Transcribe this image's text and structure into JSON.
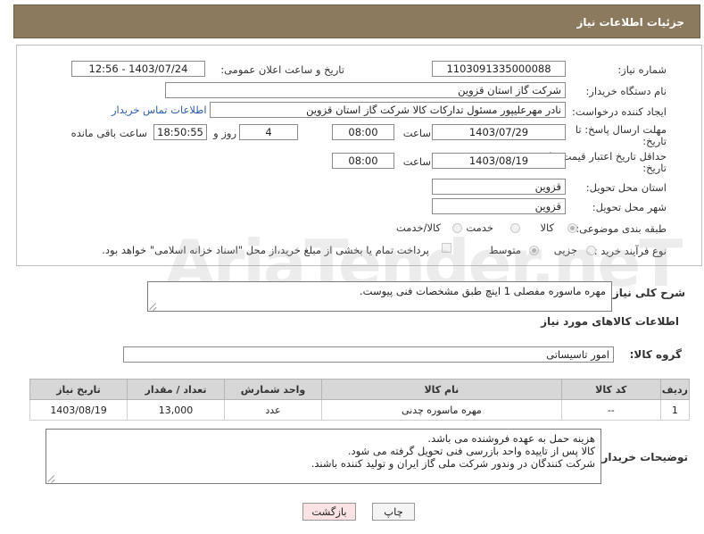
{
  "header": {
    "title": "جزئیات اطلاعات نیاز"
  },
  "form": {
    "need_number": {
      "label": "شماره نیاز:",
      "value": "1103091335000088"
    },
    "announce_datetime": {
      "label": "تاریخ و ساعت اعلان عمومی:",
      "value": "1403/07/24 - 12:56"
    },
    "buyer_org": {
      "label": "نام دستگاه خریدار:",
      "value": "شرکت گاز استان قزوین"
    },
    "requester": {
      "label": "ایجاد کننده درخواست:",
      "value": "نادر مهرعلیپور مسئول تدارکات کالا شرکت گاز استان قزوین",
      "link": "اطلاعات تماس خریدار"
    },
    "reply_deadline": {
      "label_line1": "مهلت ارسال پاسخ: تا",
      "label_line2": "تاریخ:",
      "date": "1403/07/29",
      "time_label": "ساعت",
      "time": "08:00",
      "days": "4",
      "days_label": "روز و",
      "remaining": "18:50:55",
      "remaining_label": "ساعت باقی مانده"
    },
    "price_validity": {
      "label_line1": "حداقل تاریخ اعتبار قیمت: تا",
      "label_line2": "تاریخ:",
      "date": "1403/08/19",
      "time_label": "ساعت",
      "time": "08:00"
    },
    "delivery_province": {
      "label": "استان محل تحویل:",
      "value": "قزوین"
    },
    "delivery_city": {
      "label": "شهر محل تحویل:",
      "value": "قزوین"
    },
    "category": {
      "label": "طبقه بندی موضوعی:",
      "options": [
        "کالا",
        "خدمت",
        "کالا/خدمت"
      ],
      "selected": "کالا"
    },
    "purchase_type": {
      "label": "نوع فرآیند خرید :",
      "options": [
        "جزیی",
        "متوسط"
      ],
      "selected": "متوسط",
      "payment_note": "پرداخت تمام یا بخشی از مبلغ خرید،از محل \"اسناد خزانه اسلامی\" خواهد بود."
    }
  },
  "description": {
    "label": "شرح کلی نیاز:",
    "value": "مهره ماسوره مفصلی 1 اینچ طبق مشخصات فنی پیوست."
  },
  "goods_section": {
    "title": "اطلاعات کالاهای مورد نیاز",
    "group_label": "گروه کالا:",
    "group_value": "امور تاسیساتی"
  },
  "table": {
    "headers": [
      "ردیف",
      "کد کالا",
      "نام کالا",
      "واحد شمارش",
      "تعداد / مقدار",
      "تاریخ نیاز"
    ],
    "rows": [
      {
        "row": "1",
        "code": "--",
        "name": "مهره ماسوره چدنی",
        "unit": "عدد",
        "qty": "13,000",
        "date": "1403/08/19"
      }
    ]
  },
  "buyer_notes": {
    "label": "توضیحات خریدار:",
    "lines": [
      "هزینه حمل به عهده فروشنده می باشد.",
      "کالا پس از تاییده واحد بازرسی فنی تحویل گرفته می شود.",
      "شرکت کنندگان در وندور شرکت ملی گاز ایران و تولید کننده باشند."
    ]
  },
  "buttons": {
    "print": "چاپ",
    "back": "بازگشت"
  },
  "watermark": "AriaTender.neT",
  "colors": {
    "header_bg": "#8c7a5e",
    "link": "#2a5db0",
    "back_button_bg": "#fbe3e3"
  }
}
